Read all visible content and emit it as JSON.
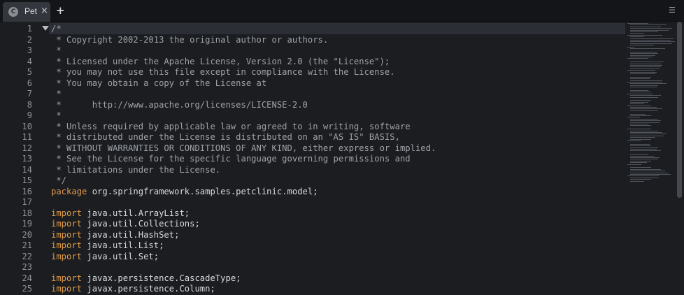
{
  "tab": {
    "icon_letter": "C",
    "label": "Pet",
    "close": "×",
    "add": "+"
  },
  "menu_icon": "☰",
  "line_numbers": [
    "1",
    "2",
    "3",
    "4",
    "5",
    "6",
    "7",
    "8",
    "9",
    "10",
    "11",
    "12",
    "13",
    "14",
    "15",
    "16",
    "17",
    "18",
    "19",
    "20",
    "21",
    "22",
    "23",
    "24",
    "25"
  ],
  "code_lines": [
    [
      {
        "t": "/*",
        "k": "comment"
      }
    ],
    [
      {
        "t": " * Copyright 2002-2013 the original author or authors.",
        "k": "comment"
      }
    ],
    [
      {
        "t": " *",
        "k": "comment"
      }
    ],
    [
      {
        "t": " * Licensed under the Apache License, Version 2.0 (the \"License\");",
        "k": "comment"
      }
    ],
    [
      {
        "t": " * you may not use this file except in compliance with the License.",
        "k": "comment"
      }
    ],
    [
      {
        "t": " * You may obtain a copy of the License at",
        "k": "comment"
      }
    ],
    [
      {
        "t": " *",
        "k": "comment"
      }
    ],
    [
      {
        "t": " *      http://www.apache.org/licenses/LICENSE-2.0",
        "k": "comment"
      }
    ],
    [
      {
        "t": " *",
        "k": "comment"
      }
    ],
    [
      {
        "t": " * Unless required by applicable law or agreed to in writing, software",
        "k": "comment"
      }
    ],
    [
      {
        "t": " * distributed under the License is distributed on an \"AS IS\" BASIS,",
        "k": "comment"
      }
    ],
    [
      {
        "t": " * WITHOUT WARRANTIES OR CONDITIONS OF ANY KIND, either express or implied.",
        "k": "comment"
      }
    ],
    [
      {
        "t": " * See the License for the specific language governing permissions and",
        "k": "comment"
      }
    ],
    [
      {
        "t": " * limitations under the License.",
        "k": "comment"
      }
    ],
    [
      {
        "t": " */",
        "k": "comment"
      }
    ],
    [
      {
        "t": "package",
        "k": "keyword"
      },
      {
        "t": " org.springframework.samples.petclinic.model;",
        "k": "plain"
      }
    ],
    [
      {
        "t": "",
        "k": "plain"
      }
    ],
    [
      {
        "t": "import",
        "k": "keyword"
      },
      {
        "t": " java.util.ArrayList;",
        "k": "plain"
      }
    ],
    [
      {
        "t": "import",
        "k": "keyword"
      },
      {
        "t": " java.util.Collections;",
        "k": "plain"
      }
    ],
    [
      {
        "t": "import",
        "k": "keyword"
      },
      {
        "t": " java.util.HashSet;",
        "k": "plain"
      }
    ],
    [
      {
        "t": "import",
        "k": "keyword"
      },
      {
        "t": " java.util.List;",
        "k": "plain"
      }
    ],
    [
      {
        "t": "import",
        "k": "keyword"
      },
      {
        "t": " java.util.Set;",
        "k": "plain"
      }
    ],
    [
      {
        "t": "",
        "k": "plain"
      }
    ],
    [
      {
        "t": "import",
        "k": "keyword"
      },
      {
        "t": " javax.persistence.CascadeType;",
        "k": "plain"
      }
    ],
    [
      {
        "t": "import",
        "k": "keyword"
      },
      {
        "t": " javax.persistence.Column;",
        "k": "plain"
      }
    ]
  ],
  "colors": {
    "background": "#1b1d21",
    "comment": "#9ea2a7",
    "keyword": "#e09a4a",
    "plain": "#d7d9dc",
    "line_number": "#8f9296"
  }
}
